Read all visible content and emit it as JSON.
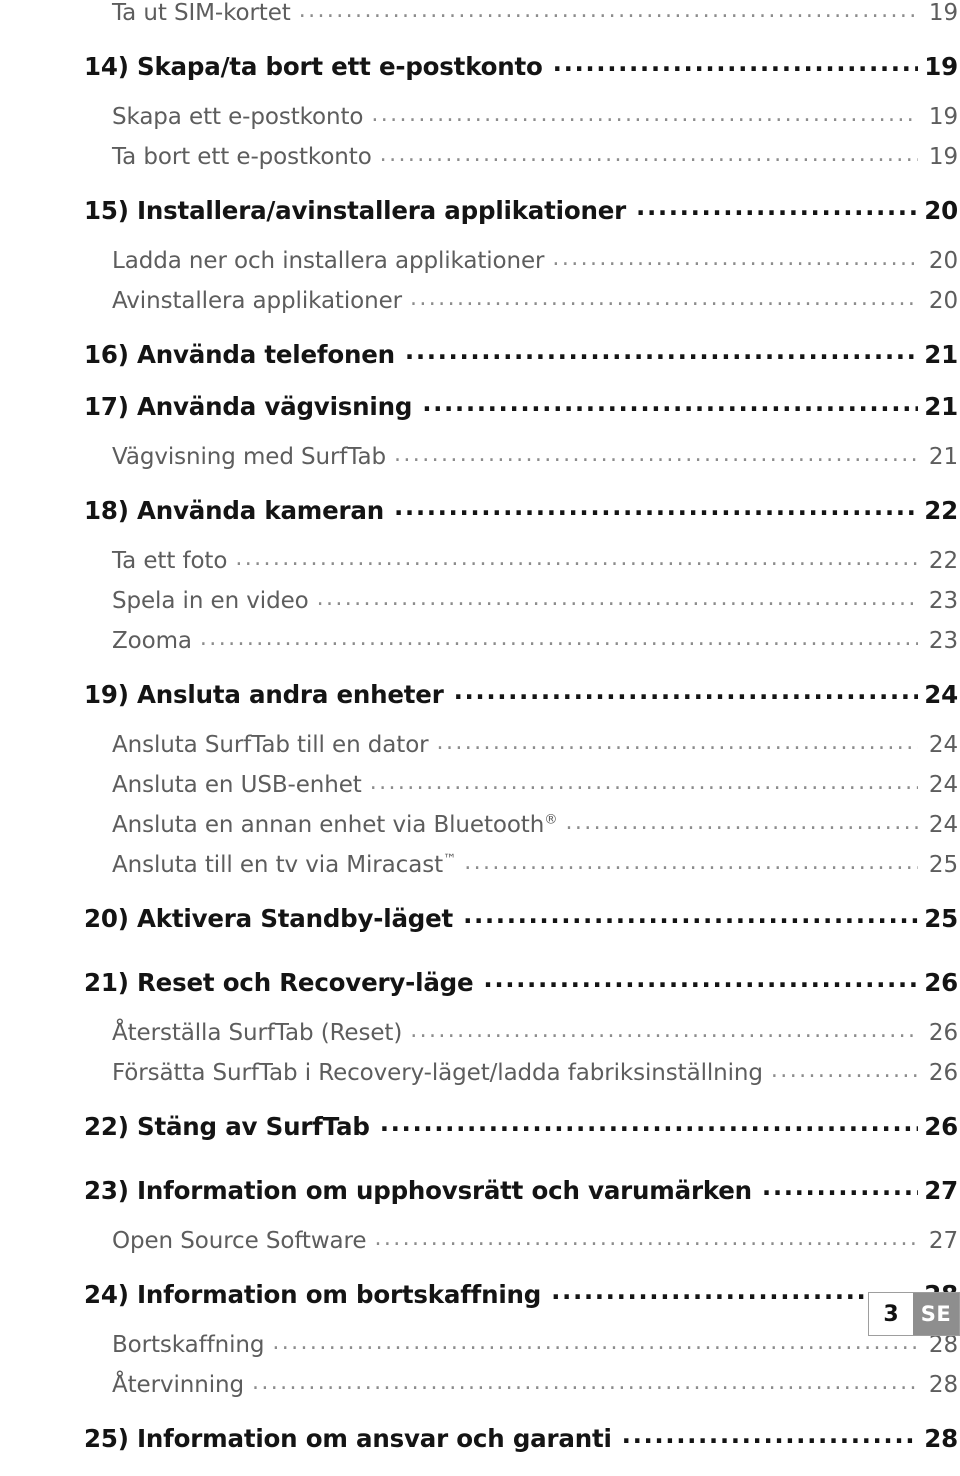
{
  "document": {
    "type": "table-of-contents",
    "language": "SE"
  },
  "entries": [
    {
      "level": 2,
      "label": "Ta ut SIM-kortet",
      "page": "19",
      "gap": false
    },
    {
      "level": 1,
      "label": "14) Skapa/ta bort ett e-postkonto",
      "page": "19",
      "gap": true
    },
    {
      "level": 2,
      "label": "Skapa ett e-postkonto",
      "page": "19",
      "gap": false
    },
    {
      "level": 2,
      "label": "Ta bort ett e-postkonto",
      "page": "19",
      "gap": false
    },
    {
      "level": 1,
      "label": "15) Installera/avinstallera applikationer",
      "page": "20",
      "gap": true
    },
    {
      "level": 2,
      "label": "Ladda ner och installera applikationer",
      "page": "20",
      "gap": false
    },
    {
      "level": 2,
      "label": "Avinstallera applikationer",
      "page": "20",
      "gap": false
    },
    {
      "level": 1,
      "label": "16) Använda telefonen",
      "page": "21",
      "gap": true
    },
    {
      "level": 1,
      "label": "17) Använda vägvisning",
      "page": "21",
      "gap": false
    },
    {
      "level": 2,
      "label": "Vägvisning med SurfTab",
      "page": "21",
      "gap": false
    },
    {
      "level": 1,
      "label": "18) Använda kameran",
      "page": "22",
      "gap": true
    },
    {
      "level": 2,
      "label": "Ta ett foto",
      "page": "22",
      "gap": false
    },
    {
      "level": 2,
      "label": "Spela in en video",
      "page": "23",
      "gap": false
    },
    {
      "level": 2,
      "label": "Zooma",
      "page": "23",
      "gap": false
    },
    {
      "level": 1,
      "label": "19) Ansluta andra enheter",
      "page": "24",
      "gap": true
    },
    {
      "level": 2,
      "label": "Ansluta SurfTab till en dator",
      "page": "24",
      "gap": false
    },
    {
      "level": 2,
      "label": "Ansluta en USB-enhet",
      "page": "24",
      "gap": false
    },
    {
      "level": 2,
      "label": "Ansluta en annan enhet via Bluetooth®",
      "page": "24",
      "gap": false,
      "sup": "®",
      "base": "Ansluta en annan enhet via Bluetooth"
    },
    {
      "level": 2,
      "label": "Ansluta till en tv via Miracast™",
      "page": "25",
      "gap": false,
      "sup": "™",
      "base": "Ansluta till en tv via Miracast"
    },
    {
      "level": 1,
      "label": "20) Aktivera Standby-läget",
      "page": "25",
      "gap": true
    },
    {
      "level": 1,
      "label": "21) Reset och Recovery-läge",
      "page": "26",
      "gap": true
    },
    {
      "level": 2,
      "label": "Återställa SurfTab (Reset)",
      "page": "26",
      "gap": false
    },
    {
      "level": 2,
      "label": "Försätta SurfTab i Recovery-läget/ladda fabriksinställning",
      "page": "26",
      "gap": false
    },
    {
      "level": 1,
      "label": "22) Stäng av SurfTab",
      "page": "26",
      "gap": true
    },
    {
      "level": 1,
      "label": "23) Information om upphovsrätt och varumärken",
      "page": "27",
      "gap": true
    },
    {
      "level": 2,
      "label": "Open Source Software",
      "page": "27",
      "gap": false
    },
    {
      "level": 1,
      "label": "24) Information om bortskaffning",
      "page": "28",
      "gap": true
    },
    {
      "level": 2,
      "label": "Bortskaffning",
      "page": "28",
      "gap": false
    },
    {
      "level": 2,
      "label": "Återvinning",
      "page": "28",
      "gap": false
    },
    {
      "level": 1,
      "label": "25) Information om ansvar och garanti",
      "page": "28",
      "gap": true
    }
  ],
  "footer": {
    "page_number": "3",
    "language_code": "SE",
    "rule_style": "dotted"
  },
  "colors": {
    "heading_text": "#141414",
    "subitem_text": "#5d5d5d",
    "leader_dots": "#8c8c8c",
    "badge_lang_bg": "#8e8e8e",
    "badge_border": "#9e9e9e"
  }
}
